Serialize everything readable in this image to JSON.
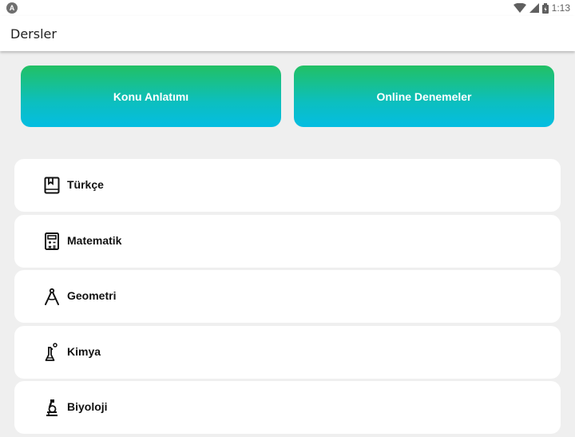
{
  "status_bar": {
    "time": "1:13",
    "icons": [
      "app-notification-icon",
      "wifi-icon",
      "signal-icon",
      "battery-icon"
    ]
  },
  "app_bar": {
    "title": "Dersler"
  },
  "buttons": {
    "konu": "Konu Anlatımı",
    "online": "Online Denemeler"
  },
  "colors": {
    "gradient_top": "#22c064",
    "gradient_bottom": "#04bde2",
    "card_bg": "#ffffff",
    "page_bg": "#efefef"
  },
  "subjects": [
    {
      "label": "Türkçe",
      "icon": "book-icon"
    },
    {
      "label": "Matematik",
      "icon": "calculator-icon"
    },
    {
      "label": "Geometri",
      "icon": "compass-icon"
    },
    {
      "label": "Kimya",
      "icon": "flask-icon"
    },
    {
      "label": "Biyoloji",
      "icon": "microscope-icon"
    }
  ]
}
